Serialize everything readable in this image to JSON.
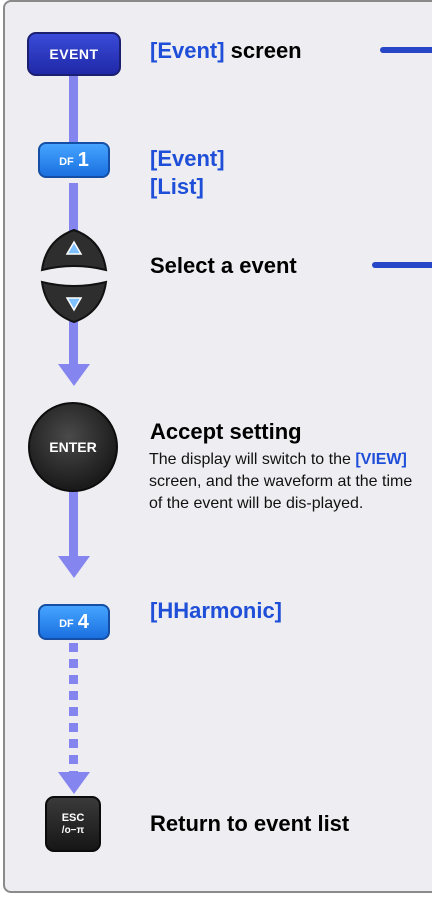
{
  "steps": {
    "event_key_label": "EVENT",
    "event_screen": {
      "bracket": "[Event]",
      "rest": " screen"
    },
    "df1": {
      "prefix": "DF",
      "num": "1"
    },
    "menu_line1": "[Event]",
    "menu_line2": "[List]",
    "select_label": "Select a event",
    "enter_key_label": "ENTER",
    "accept_title": "Accept setting",
    "accept_desc": {
      "before": "The display will switch to the ",
      "highlight": "[VIEW]",
      "after": " screen, and the waveform at the time of the event will be dis-played."
    },
    "df4": {
      "prefix": "DF",
      "num": "4"
    },
    "hharmonic_label": "[HHarmonic]",
    "esc_key": {
      "top": "ESC",
      "bottom": "/o−π"
    },
    "return_label": "Return to event list"
  },
  "colors": {
    "flow_line": "#8585f0",
    "accent_text": "#1f4fd8",
    "pointer_line": "#2846c8"
  }
}
